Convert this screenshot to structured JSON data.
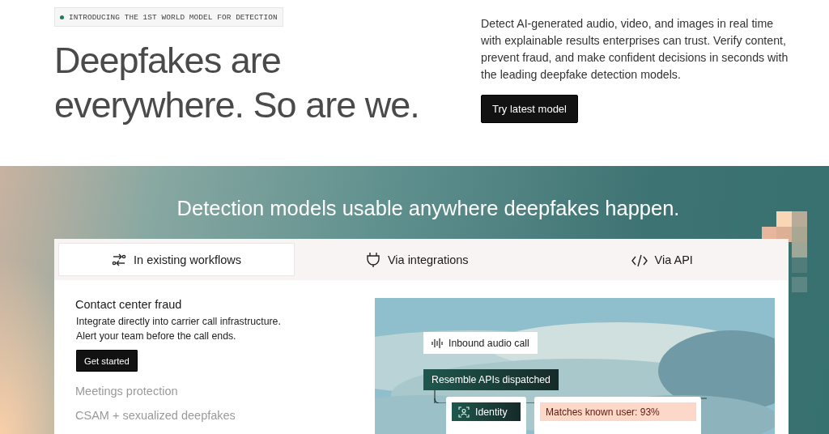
{
  "hero": {
    "tag": "INTRODUCING THE 1ST WORLD MODEL FOR DETECTION",
    "headline": [
      "Deepfakes are",
      "everywhere. So are we."
    ],
    "description": "Detect AI-generated audio, video, and images in real time with explainable results enterprises can trust. Verify content, prevent fraud, and make confident decisions in seconds with the leading deepfake detection models.",
    "button": "Try latest model"
  },
  "section": {
    "title": "Detection models usable anywhere deepfakes happen.",
    "tabs": [
      {
        "label": "In existing workflows",
        "kind": "workflow",
        "selected": true
      },
      {
        "label": "Via integrations",
        "kind": "plug",
        "selected": false
      },
      {
        "label": "Via API",
        "kind": "code",
        "selected": false
      }
    ],
    "use_cases": [
      {
        "title": "Contact center fraud",
        "expanded": true,
        "lines": [
          "Integrate directly into carrier call infrastructure.",
          "Alert your team before the call ends."
        ],
        "button": "Get started"
      },
      {
        "title": "Meetings protection",
        "expanded": false
      },
      {
        "title": "CSAM + sexualized deepfakes",
        "expanded": false
      }
    ],
    "diagram": {
      "source": "Inbound audio call",
      "dispatch": "Resemble APIs dispatched",
      "check": "Identity",
      "result": "Matches known user: 93%"
    }
  }
}
